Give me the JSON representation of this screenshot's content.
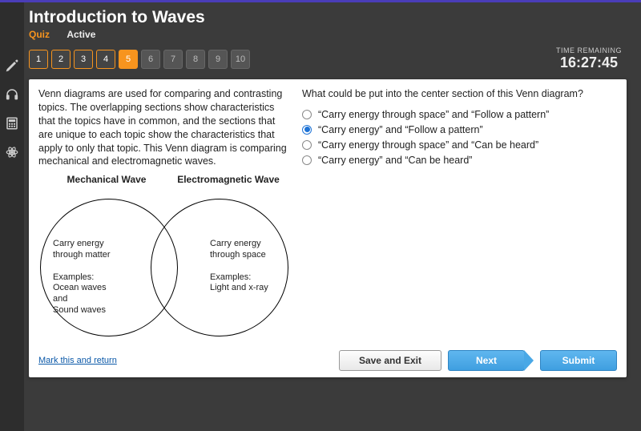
{
  "header": {
    "title": "Introduction to Waves",
    "quiz_label": "Quiz",
    "status": "Active"
  },
  "timer": {
    "label": "TIME REMAINING",
    "value": "16:27:45"
  },
  "questions": {
    "nums": [
      "1",
      "2",
      "3",
      "4",
      "5",
      "6",
      "7",
      "8",
      "9",
      "10"
    ],
    "answered_count": 4,
    "current_index": 4
  },
  "passage": "Venn diagrams are used for comparing and contrasting topics. The overlapping sections show characteristics that the topics have in common, and the sections that are unique to each topic show the characteristics that apply to only that topic. This Venn diagram is comparing mechanical and electromagnetic waves.",
  "venn": {
    "left_label": "Mechanical\nWave",
    "right_label": "Electromagnetic\nWave",
    "left_text": "Carry energy\nthrough matter\n\nExamples:\nOcean waves\nand\nSound waves",
    "right_text": "Carry energy\nthrough space\n\nExamples:\nLight and x-ray"
  },
  "prompt": "What could be put into the center section of this Venn diagram?",
  "options": [
    "“Carry energy through space” and “Follow a pattern”",
    "“Carry energy” and “Follow a pattern”",
    "“Carry energy through space” and “Can be heard”",
    "“Carry energy” and “Can be heard”"
  ],
  "selected_option": 1,
  "footer": {
    "mark": "Mark this and return",
    "save": "Save and Exit",
    "next": "Next",
    "submit": "Submit"
  }
}
